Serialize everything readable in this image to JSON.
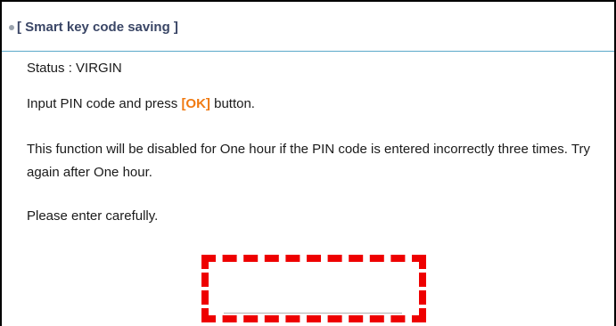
{
  "panel": {
    "title": "[ Smart key code saving ]"
  },
  "status": {
    "text": "Status : VIRGIN"
  },
  "instruction": {
    "prefix": "Input PIN code and press ",
    "ok_label": "[OK]",
    "suffix": " button."
  },
  "warning": {
    "text": "This function will be disabled for One hour if the PIN code is entered incorrectly three times. Try again after One hour."
  },
  "caution": {
    "text": "Please enter carefully."
  },
  "pin_input": {
    "value": "",
    "placeholder": ""
  },
  "colors": {
    "header_text": "#3a4666",
    "header_rule": "#5aa9c9",
    "ok_accent": "#f07a12",
    "highlight_box": "#ee0000"
  }
}
